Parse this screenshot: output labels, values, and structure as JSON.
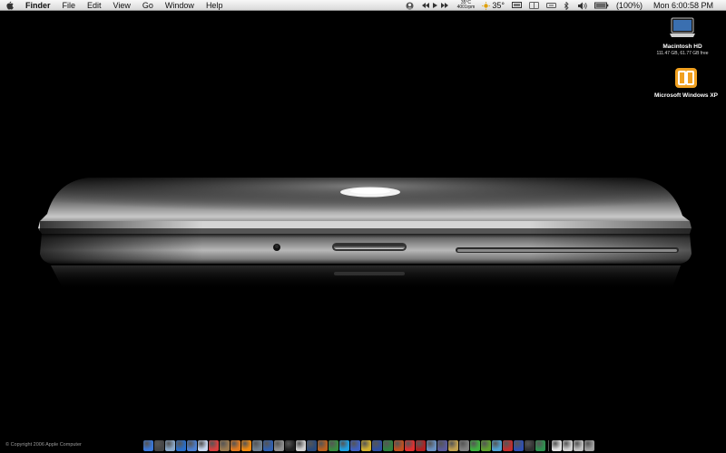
{
  "menubar": {
    "app_name": "Finder",
    "menus": [
      "File",
      "Edit",
      "View",
      "Go",
      "Window",
      "Help"
    ],
    "temperature": "35°C",
    "fan_speed": "4001rpm",
    "weather": "35°",
    "battery": "(100%)",
    "clock": "Mon 6:00:58 PM"
  },
  "desktop": {
    "icons": [
      {
        "label": "Macintosh HD",
        "sub": "111.47 GB, 61.77 GB free",
        "icon": "hard-drive-icon"
      },
      {
        "label": "Microsoft Windows XP",
        "sub": "",
        "icon": "parallels-vm-icon"
      }
    ]
  },
  "footer": {
    "copyright": "© Copyright 2006 Apple Computer"
  },
  "dock": {
    "items": [
      {
        "icon": "finder-icon",
        "color": "#3b78d8"
      },
      {
        "icon": "dashboard-icon",
        "color": "#444444"
      },
      {
        "icon": "mail-icon",
        "color": "#8aa8c8"
      },
      {
        "icon": "safari-icon",
        "color": "#2a6ec8"
      },
      {
        "icon": "ichat-icon",
        "color": "#4c7fd0"
      },
      {
        "icon": "itunes-icon",
        "color": "#c8d8f0"
      },
      {
        "icon": "calendar-icon",
        "color": "#d84040"
      },
      {
        "icon": "address-book-icon",
        "color": "#9a7a50"
      },
      {
        "icon": "firefox-icon",
        "color": "#e07a20"
      },
      {
        "icon": "vlc-icon",
        "color": "#f08a10"
      },
      {
        "icon": "preview-icon",
        "color": "#708090"
      },
      {
        "icon": "quicktime-icon",
        "color": "#3060b0"
      },
      {
        "icon": "system-prefs-icon",
        "color": "#909090"
      },
      {
        "icon": "terminal-icon",
        "color": "#202020"
      },
      {
        "icon": "textedit-icon",
        "color": "#d0d0d0"
      },
      {
        "icon": "photoshop-icon",
        "color": "#2a4a7a"
      },
      {
        "icon": "illustrator-icon",
        "color": "#b86020"
      },
      {
        "icon": "dreamweaver-icon",
        "color": "#3a8a40"
      },
      {
        "icon": "skype-icon",
        "color": "#20a0e0"
      },
      {
        "icon": "itunes-store-icon",
        "color": "#4060c0"
      },
      {
        "icon": "star-app-icon",
        "color": "#d0b030"
      },
      {
        "icon": "office-word-icon",
        "color": "#3050a0"
      },
      {
        "icon": "office-excel-icon",
        "color": "#308040"
      },
      {
        "icon": "office-ppt-icon",
        "color": "#c05020"
      },
      {
        "icon": "ical-icon",
        "color": "#e03030"
      },
      {
        "icon": "photo-booth-icon",
        "color": "#b02020"
      },
      {
        "icon": "iphoto-icon",
        "color": "#6a90c0"
      },
      {
        "icon": "imovie-icon",
        "color": "#5a5a9a"
      },
      {
        "icon": "garageband-icon",
        "color": "#c0a050"
      },
      {
        "icon": "idvd-icon",
        "color": "#808080"
      },
      {
        "icon": "limewire-icon",
        "color": "#40b040"
      },
      {
        "icon": "utorrent-icon",
        "color": "#60a030"
      },
      {
        "icon": "adium-icon",
        "color": "#50a0d0"
      },
      {
        "icon": "parallels-icon",
        "color": "#c03030"
      },
      {
        "icon": "media-player-icon",
        "color": "#3050b0"
      },
      {
        "icon": "toast-icon",
        "color": "#303030"
      },
      {
        "icon": "money-app-icon",
        "color": "#309050"
      },
      {
        "icon": "sep",
        "color": "#000000"
      },
      {
        "icon": "documents-folder-icon",
        "color": "#e0e0e0"
      },
      {
        "icon": "downloads-folder-icon",
        "color": "#d0d0d0"
      },
      {
        "icon": "applications-folder-icon",
        "color": "#c0c0c0"
      },
      {
        "icon": "trash-icon",
        "color": "#a0a0a0"
      }
    ]
  }
}
